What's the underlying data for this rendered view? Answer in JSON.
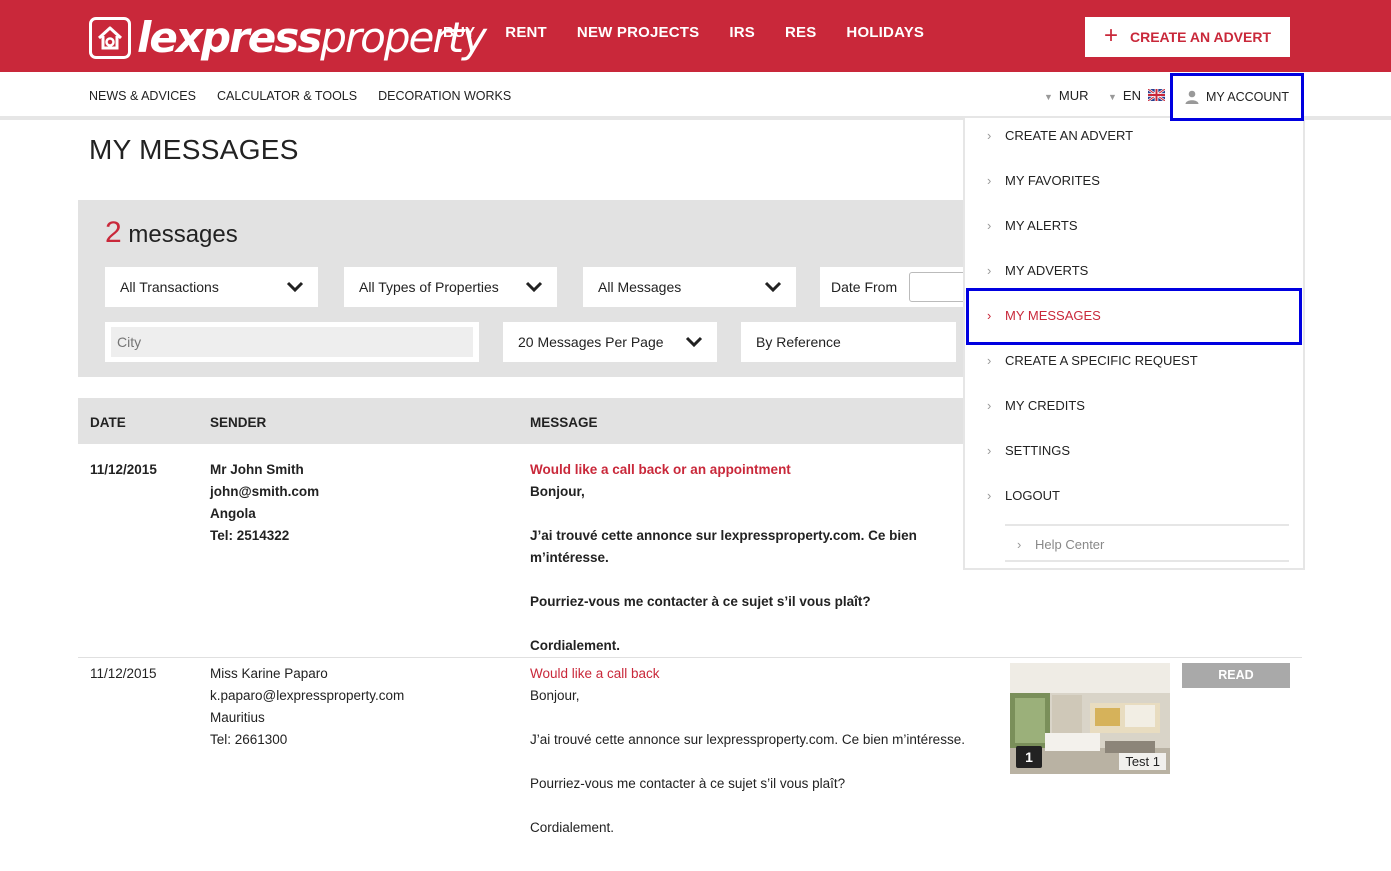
{
  "brand": {
    "name_bold": "lexpress",
    "name_light": "property"
  },
  "nav": [
    "BUY",
    "RENT",
    "NEW PROJECTS",
    "IRS",
    "RES",
    "HOLIDAYS"
  ],
  "cta": {
    "label": "CREATE AN ADVERT"
  },
  "subnav": [
    "NEWS & ADVICES",
    "CALCULATOR & TOOLS",
    "DECORATION WORKS"
  ],
  "currency": "MUR",
  "language": "EN",
  "account": {
    "label": "MY ACCOUNT"
  },
  "page": {
    "title": "MY MESSAGES"
  },
  "summary": {
    "count": "2",
    "label": "messages"
  },
  "filters": {
    "transactions": "All Transactions",
    "property_types": "All Types of Properties",
    "messages": "All Messages",
    "date_from": "Date From",
    "city_placeholder": "City",
    "per_page": "20 Messages Per Page",
    "sort": "By Reference"
  },
  "table": {
    "headers": [
      "DATE",
      "SENDER",
      "MESSAGE"
    ],
    "rows": [
      {
        "date": "11/12/2015",
        "sender_name": "Mr John Smith",
        "sender_email": "john@smith.com",
        "sender_country": "Angola",
        "sender_tel": "Tel: 2514322",
        "subject": "Would like a call back or an appointment",
        "greeting": "Bonjour,",
        "body1": "J’ai trouvé cette annonce sur lexpressproperty.com. Ce bien m’intéresse.",
        "body2": "Pourriez-vous me contacter à ce sujet s’il vous plaît?",
        "closing": "Cordialement."
      },
      {
        "date": "11/12/2015",
        "sender_name": "Miss Karine Paparo",
        "sender_email": "k.paparo@lexpressproperty.com",
        "sender_country": "Mauritius",
        "sender_tel": "Tel: 2661300",
        "subject": "Would like a call back",
        "greeting": "Bonjour,",
        "body1": "J’ai trouvé cette annonce sur lexpressproperty.com. Ce bien m’intéresse.",
        "body2": "Pourriez-vous me contacter à ce sujet s’il vous plaît?",
        "closing": "Cordialement.",
        "thumb_count": "1",
        "thumb_caption": "Test 1",
        "status": "READ"
      }
    ]
  },
  "account_menu": {
    "items": [
      "CREATE AN ADVERT",
      "MY FAVORITES",
      "MY ALERTS",
      "MY ADVERTS",
      "MY MESSAGES",
      "CREATE A SPECIFIC REQUEST",
      "MY CREDITS",
      "SETTINGS",
      "LOGOUT"
    ],
    "active": "MY MESSAGES",
    "help": "Help Center"
  },
  "colors": {
    "brand_red": "#c9283a",
    "highlight_blue": "#0000e0",
    "panel_gray": "#e2e2e2"
  }
}
